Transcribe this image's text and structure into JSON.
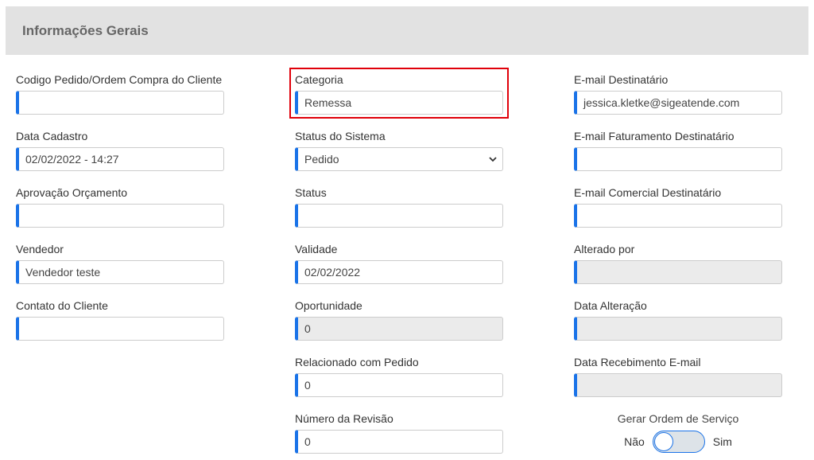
{
  "panel": {
    "title": "Informações Gerais"
  },
  "col1": {
    "codigo_label": "Codigo Pedido/Ordem Compra do Cliente",
    "codigo_value": "",
    "data_cadastro_label": "Data Cadastro",
    "data_cadastro_value": "02/02/2022 - 14:27",
    "aprovacao_label": "Aprovação Orçamento",
    "aprovacao_value": "",
    "vendedor_label": "Vendedor",
    "vendedor_value": "Vendedor teste",
    "contato_label": "Contato do Cliente",
    "contato_value": ""
  },
  "col2": {
    "categoria_label": "Categoria",
    "categoria_value": "Remessa",
    "status_sistema_label": "Status do Sistema",
    "status_sistema_value": "Pedido",
    "status_label": "Status",
    "status_value": "",
    "validade_label": "Validade",
    "validade_value": "02/02/2022",
    "oportunidade_label": "Oportunidade",
    "oportunidade_value": "0",
    "relacionado_label": "Relacionado com Pedido",
    "relacionado_value": "0",
    "revisao_label": "Número da Revisão",
    "revisao_value": "0"
  },
  "col3": {
    "email_dest_label": "E-mail Destinatário",
    "email_dest_value": "jessica.kletke@sigeatende.com",
    "email_fat_label": "E-mail Faturamento Destinatário",
    "email_fat_value": "",
    "email_com_label": "E-mail Comercial Destinatário",
    "email_com_value": "",
    "alterado_label": "Alterado por",
    "alterado_value": "",
    "data_alt_label": "Data Alteração",
    "data_alt_value": "",
    "data_rec_label": "Data Recebimento E-mail",
    "data_rec_value": ""
  },
  "toggle": {
    "title": "Gerar Ordem de Serviço",
    "off_label": "Não",
    "on_label": "Sim",
    "state": "off"
  },
  "colors": {
    "accent": "#1a73e8",
    "highlight": "#e0000a",
    "header_bg": "#e2e2e2",
    "readonly_bg": "#ebebeb"
  }
}
